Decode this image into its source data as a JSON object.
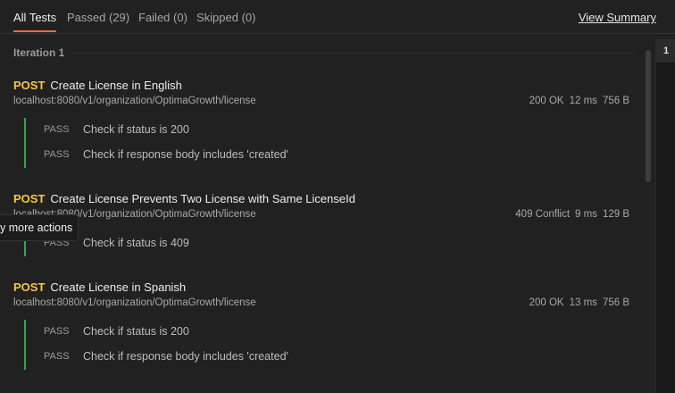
{
  "tabs": [
    {
      "label": "All Tests",
      "active": true
    },
    {
      "label": "Passed (29)"
    },
    {
      "label": "Failed (0)"
    },
    {
      "label": "Skipped (0)"
    }
  ],
  "view_summary": "View Summary",
  "iteration_label": "Iteration 1",
  "requests": [
    {
      "method": "POST",
      "name": "Create License in English",
      "url": "localhost:8080/v1/organization/OptimaGrowth/license",
      "status": "200 OK",
      "time": "12 ms",
      "size": "756 B",
      "tests": [
        {
          "result": "PASS",
          "name": "Check if status is 200"
        },
        {
          "result": "PASS",
          "name": "Check if response body includes 'created'"
        }
      ]
    },
    {
      "method": "POST",
      "name": "Create License Prevents Two License with Same LicenseId",
      "url": "localhost:8080/v1/organization/OptimaGrowth/license",
      "status": "409 Conflict",
      "time": "9 ms",
      "size": "129 B",
      "tests": [
        {
          "result": "PASS",
          "name": "Check if status is 409"
        }
      ]
    },
    {
      "method": "POST",
      "name": "Create License in Spanish",
      "url": "localhost:8080/v1/organization/OptimaGrowth/license",
      "status": "200 OK",
      "time": "13 ms",
      "size": "756 B",
      "tests": [
        {
          "result": "PASS",
          "name": "Check if status is 200"
        },
        {
          "result": "PASS",
          "name": "Check if response body includes 'created'"
        }
      ]
    }
  ],
  "tooltip": "y more actions",
  "iteration_number": "1",
  "colors": {
    "background": "#212121",
    "accent": "#f26b3a",
    "method": "#f5c842",
    "pass_bar": "#2fa84f"
  }
}
